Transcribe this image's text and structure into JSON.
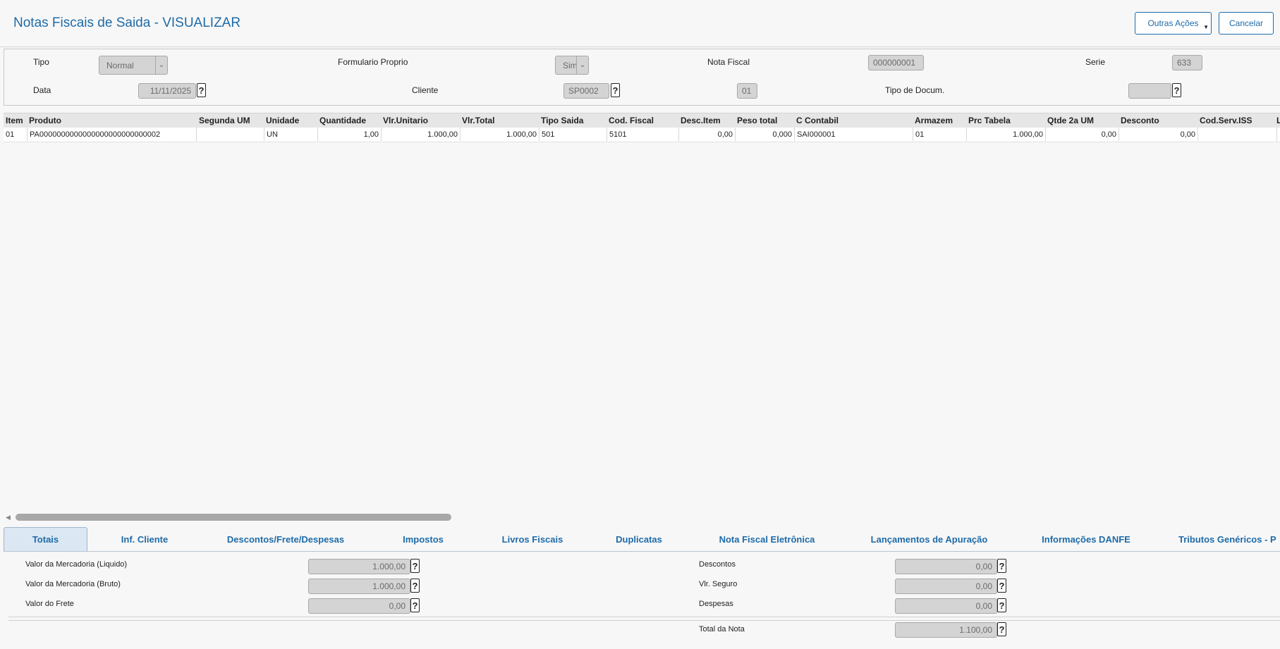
{
  "header": {
    "title": "Notas Fiscais de Saida - VISUALIZAR",
    "other_actions_label": "Outras Ações",
    "cancel_label": "Cancelar"
  },
  "form": {
    "tipo_label": "Tipo",
    "tipo_value": "Normal",
    "formulario_label": "Formulario Proprio",
    "formulario_value": "Sim",
    "nota_label": "Nota Fiscal",
    "nota_value": "000000001",
    "serie_label": "Serie",
    "serie_value": "633",
    "data_label": "Data",
    "data_value": "11/11/2025",
    "cliente_label": "Cliente",
    "cliente_value": "SP0002",
    "loja_value": "01",
    "tipo_doc_label": "Tipo de Docum.",
    "tipo_doc_value": ""
  },
  "grid": {
    "columns": [
      "Item",
      "Produto",
      "Segunda UM",
      "Unidade",
      "Quantidade",
      "Vlr.Unitario",
      "Vlr.Total",
      "Tipo Saida",
      "Cod. Fiscal",
      "Desc.Item",
      "Peso total",
      "C Contabil",
      "Armazem",
      "Prc Tabela",
      "Qtde 2a UM",
      "Desconto",
      "Cod.Serv.ISS",
      "L"
    ],
    "rows": [
      [
        "01",
        "PA0000000000000000000000000002",
        "",
        "UN",
        "1,00",
        "1.000,00",
        "1.000,00",
        "501",
        "5101",
        "0,00",
        "0,000",
        "SAI000001",
        "01",
        "1.000,00",
        "0,00",
        "0,00",
        "",
        ""
      ]
    ]
  },
  "tabs": [
    "Totais",
    "Inf. Cliente",
    "Descontos/Frete/Despesas",
    "Impostos",
    "Livros Fiscais",
    "Duplicatas",
    "Nota Fiscal Eletrônica",
    "Lançamentos de Apuração",
    "Informações DANFE",
    "Tributos Genéricos - P"
  ],
  "totais": {
    "mercadoria_liquido_label": "Valor da Mercadoria (Liquido)",
    "mercadoria_liquido_value": "1.000,00",
    "mercadoria_bruto_label": "Valor da Mercadoria (Bruto)",
    "mercadoria_bruto_value": "1.000,00",
    "frete_label": "Valor do Frete",
    "frete_value": "0,00",
    "descontos_label": "Descontos",
    "descontos_value": "0,00",
    "seguro_label": "Vlr. Seguro",
    "seguro_value": "0,00",
    "despesas_label": "Despesas",
    "despesas_value": "0,00",
    "total_label": "Total da Nota",
    "total_value": "1.100,00"
  },
  "icons": {
    "help_glyph": "?",
    "dropdown_glyph": "⌄",
    "caret_glyph": "▼",
    "scroll_left_glyph": "◀"
  }
}
